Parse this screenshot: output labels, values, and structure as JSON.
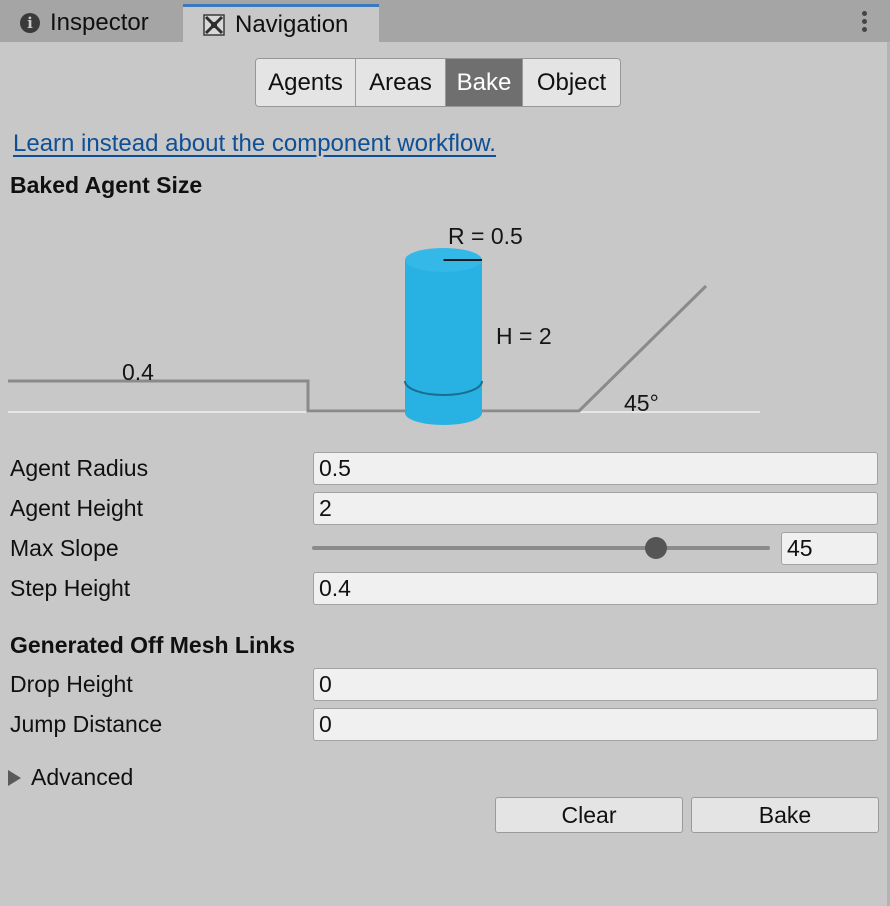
{
  "tabs": [
    {
      "label": "Inspector",
      "icon": "info-icon"
    },
    {
      "label": "Navigation",
      "icon": "navigation-icon",
      "active": true
    }
  ],
  "segments": [
    {
      "label": "Agents"
    },
    {
      "label": "Areas"
    },
    {
      "label": "Bake",
      "active": true
    },
    {
      "label": "Object"
    }
  ],
  "link": "Learn instead about the component workflow.",
  "baked_agent_size": {
    "title": "Baked Agent Size",
    "radius_label": "R = 0.5",
    "height_label": "H = 2",
    "step_label": "0.4",
    "slope_label": "45°"
  },
  "fields": {
    "agent_radius": {
      "label": "Agent Radius",
      "value": "0.5"
    },
    "agent_height": {
      "label": "Agent Height",
      "value": "2"
    },
    "max_slope": {
      "label": "Max Slope",
      "value": "45",
      "slider_fraction": 0.75
    },
    "step_height": {
      "label": "Step Height",
      "value": "0.4"
    }
  },
  "offmesh": {
    "title": "Generated Off Mesh Links",
    "drop_height": {
      "label": "Drop Height",
      "value": "0"
    },
    "jump_distance": {
      "label": "Jump Distance",
      "value": "0"
    }
  },
  "advanced": {
    "label": "Advanced",
    "expanded": false
  },
  "buttons": {
    "clear": "Clear",
    "bake": "Bake"
  },
  "colors": {
    "accent_tab": "#3a79bb",
    "link": "#0f4f95",
    "cylinder": "#27b2e3",
    "active_segment": "#6f6f6f"
  }
}
